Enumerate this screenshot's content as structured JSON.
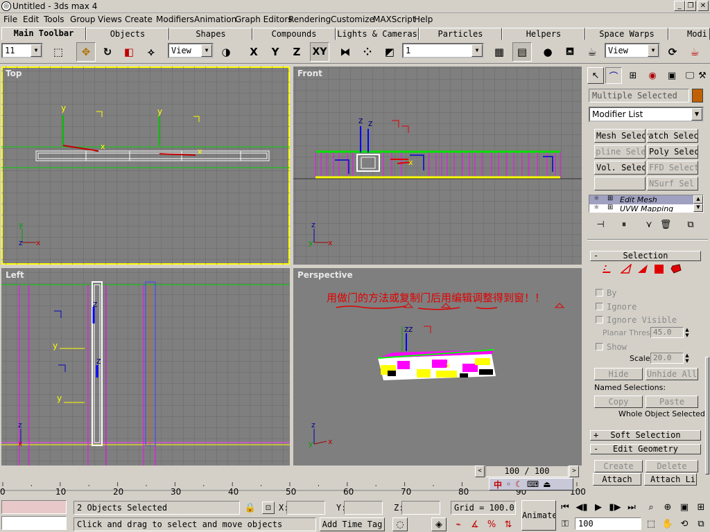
{
  "window": {
    "title": "Untitled - 3ds max 4"
  },
  "menu": [
    "File",
    "Edit",
    "Tools",
    "Group",
    "Views",
    "Create",
    "Modifiers",
    "Animation",
    "Graph Editors",
    "Rendering",
    "Customize",
    "MAXScript",
    "Help"
  ],
  "tabs": [
    "Main Toolbar",
    "Objects",
    "Shapes",
    "Compounds",
    "Lights & Cameras",
    "Particles",
    "Helpers",
    "Space Warps",
    "Modi"
  ],
  "toolbar": {
    "undo_combo": "11",
    "ref_coord": "View",
    "selection_set": "1",
    "render_view": "View",
    "axis_x": "X",
    "axis_y": "Y",
    "axis_z": "Z",
    "axis_xy": "XY"
  },
  "viewports": {
    "top": "Top",
    "front": "Front",
    "left": "Left",
    "perspective": "Perspective",
    "annotation": "用做门的方法或复制门后用编辑调整得到窗！！",
    "axis": {
      "x": "x",
      "y": "y",
      "z": "z"
    }
  },
  "command_panel": {
    "object_name": "Multiple Selected",
    "modifier_list": "Modifier List",
    "modifier_buttons": [
      "Mesh Select",
      "Patch Select",
      "Spline Select",
      "Poly Select",
      "Vol. Select",
      "FFD Select",
      "",
      "NSurf Sel"
    ],
    "stack": [
      "Edit Mesh",
      "UVW Mapping"
    ],
    "selection_rollout": {
      "title": "Selection",
      "by": "By",
      "ignore": "Ignore",
      "ignore_visible": "Ignore Visible",
      "planar_thresh_label": "Planar Thresh:",
      "planar_thresh": "45.0",
      "show": "Show",
      "scale_label": "Scale:",
      "scale": "20.0",
      "hide": "Hide",
      "unhide_all": "Unhide All",
      "named_selections": "Named Selections:",
      "copy": "Copy",
      "paste": "Paste",
      "whole_object": "Whole Object Selected"
    },
    "soft_selection": "Soft Selection",
    "edit_geometry": "Edit Geometry",
    "create": "Create",
    "delete": "Delete",
    "attach": "Attach",
    "attach_list": "Attach List"
  },
  "timeline": {
    "frame": "100 / 100",
    "ticks": [
      "0",
      "10",
      "20",
      "30",
      "40",
      "50",
      "60",
      "70",
      "80",
      "90",
      "100"
    ]
  },
  "status": {
    "selected": "2 Objects Selected",
    "prompt": "Click and drag to select and move objects",
    "x_label": "X:",
    "y_label": "Y:",
    "z_label": "Z:",
    "grid": "Grid = 100.0",
    "add_time_tag": "Add Time Tag",
    "animate": "Animate",
    "frame_field": "100"
  },
  "colors": {
    "viewport_bg": "#7f7f7f",
    "active_border": "#ffff00",
    "annotation": "#e00000",
    "gizmo_y": "#ffff00",
    "gizmo_z": "#0000ff"
  }
}
